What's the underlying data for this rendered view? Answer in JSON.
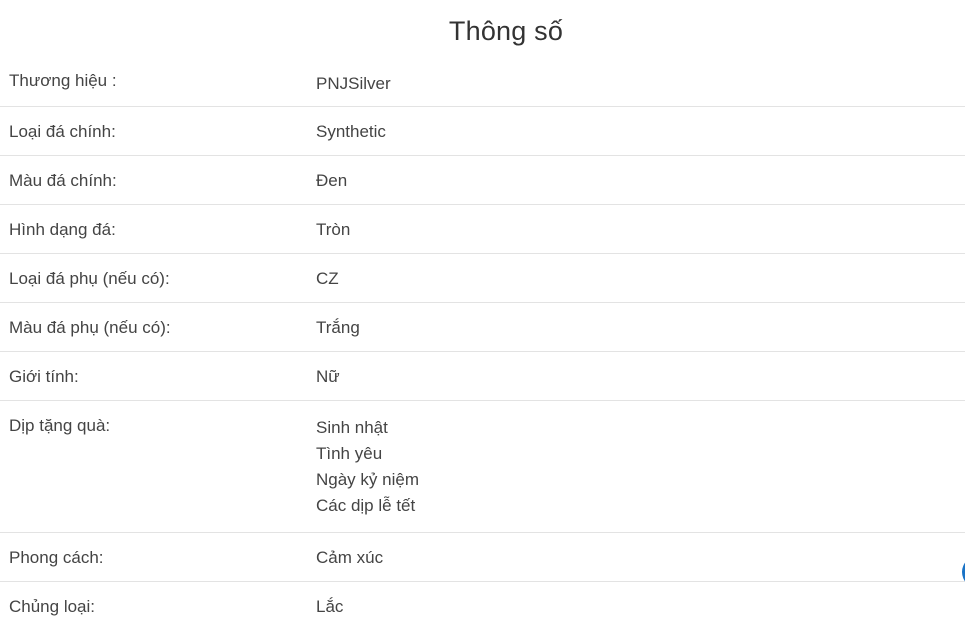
{
  "section_title": "Thông số",
  "specs": [
    {
      "label": "Thương hiệu  :",
      "values": [
        "PNJSilver"
      ]
    },
    {
      "label": "Loại đá chính:",
      "values": [
        "Synthetic"
      ]
    },
    {
      "label": "Màu đá chính:",
      "values": [
        "Đen"
      ]
    },
    {
      "label": "Hình dạng đá:",
      "values": [
        "Tròn"
      ]
    },
    {
      "label": "Loại đá phụ (nếu có):",
      "values": [
        "CZ"
      ]
    },
    {
      "label": "Màu đá phụ (nếu có):",
      "values": [
        "Trắng"
      ]
    },
    {
      "label": "Giới tính:",
      "values": [
        "Nữ"
      ]
    },
    {
      "label": "Dịp tặng quà:",
      "values": [
        "Sinh nhật",
        "Tình yêu",
        "Ngày kỷ niệm",
        "Các dịp lễ tết"
      ]
    },
    {
      "label": "Phong cách:",
      "values": [
        "Cảm xúc"
      ]
    },
    {
      "label": "Chủng loại:",
      "values": [
        "Lắc"
      ]
    }
  ],
  "colors": {
    "text": "#444444",
    "divider": "#e3e3e3",
    "floating_button": "#1a73c6"
  }
}
